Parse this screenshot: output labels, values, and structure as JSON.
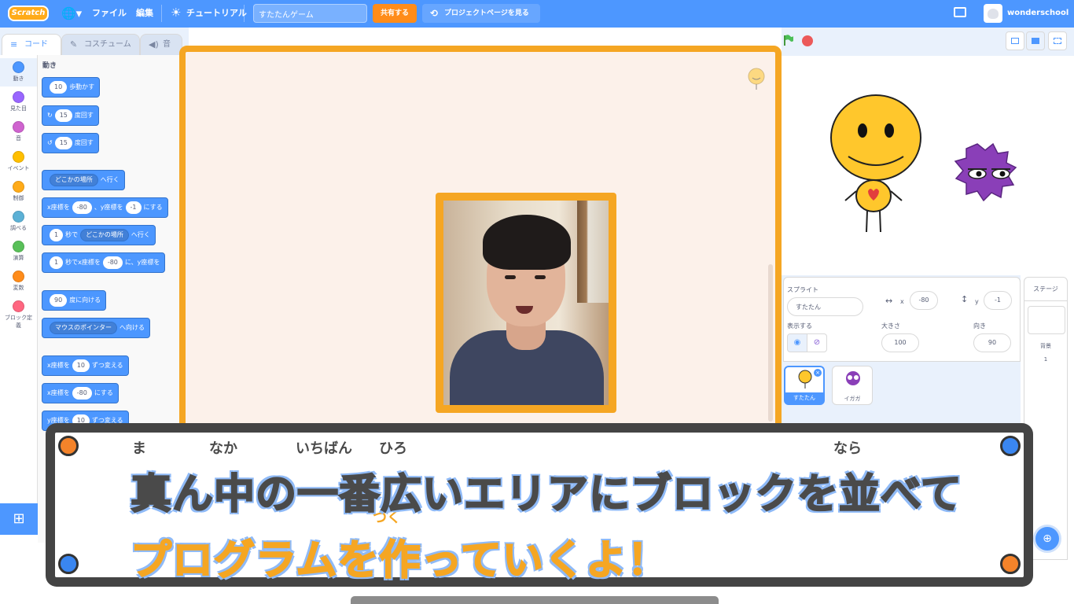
{
  "menu": {
    "logo": "Scratch",
    "file": "ファイル",
    "edit": "編集",
    "tutorials": "チュートリアル",
    "project_title": "すたたんゲーム",
    "share": "共有する",
    "see_project_page": "プロジェクトページを見る",
    "username": "wonderschool"
  },
  "tabs": {
    "code": "コード",
    "costumes": "コスチューム",
    "sounds": "音"
  },
  "categories": [
    {
      "label": "動き",
      "color": "#4c97ff"
    },
    {
      "label": "見た目",
      "color": "#9966ff"
    },
    {
      "label": "音",
      "color": "#cf63cf"
    },
    {
      "label": "イベント",
      "color": "#ffbf00"
    },
    {
      "label": "制御",
      "color": "#ffab19"
    },
    {
      "label": "調べる",
      "color": "#5cb1d6"
    },
    {
      "label": "演算",
      "color": "#59c059"
    },
    {
      "label": "変数",
      "color": "#ff8c1a"
    },
    {
      "label": "ブロック定義",
      "color": "#ff6680"
    }
  ],
  "palette": {
    "heading": "動き",
    "blocks": {
      "move": {
        "value": "10",
        "text": "歩動かす"
      },
      "turn_right": {
        "value": "15",
        "text": "度回す"
      },
      "turn_left": {
        "value": "15",
        "text": "度回す"
      },
      "goto": {
        "dropdown": "どこかの場所",
        "text": "へ行く"
      },
      "goto_xy": {
        "x_label": "x座標を",
        "x": "-80",
        "y_label": "、y座標を",
        "y": "-1",
        "end": "にする"
      },
      "glide_to": {
        "value": "1",
        "text": "秒で",
        "dropdown": "どこかの場所",
        "end": "へ行く"
      },
      "glide_xy": {
        "value": "1",
        "text": "秒でx座標を",
        "x": "-80",
        "end": "に、y座標を"
      },
      "point_dir": {
        "value": "90",
        "text": "度に向ける"
      },
      "point_towards": {
        "dropdown": "マウスのポインター",
        "text": "へ向ける"
      },
      "change_x": {
        "label": "x座標を",
        "value": "10",
        "text": "ずつ変える"
      },
      "set_x": {
        "label": "x座標を",
        "value": "-80",
        "text": "にする"
      },
      "change_y": {
        "label": "y座標を",
        "value": "10",
        "text": "ずつ変える"
      }
    }
  },
  "sprite_info": {
    "sprite_label": "スプライト",
    "sprite_name": "すたたん",
    "x_label": "x",
    "x": "-80",
    "y_label": "y",
    "y": "-1",
    "show_label": "表示する",
    "size_label": "大きさ",
    "size": "100",
    "direction_label": "向き",
    "direction": "90"
  },
  "sprites": [
    {
      "name": "すたたん",
      "selected": true
    },
    {
      "name": "イガガ",
      "selected": false
    }
  ],
  "stage_panel": {
    "title": "ステージ",
    "backdrops_label": "背景",
    "backdrops_count": "1"
  },
  "subtitle": {
    "line1": "真ん中の一番広いエリアにブロックを並べて",
    "line2": "プログラムを作っていくよ！",
    "ruby": {
      "ma": "ま",
      "naka": "なか",
      "ichiban": "いちばん",
      "hiro": "ひろ",
      "nara": "なら",
      "tsuku": "つく"
    }
  }
}
